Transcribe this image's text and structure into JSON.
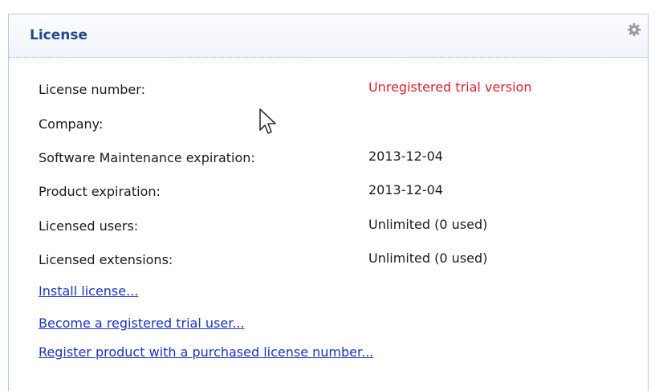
{
  "panel": {
    "title": "License"
  },
  "details": [
    {
      "label": "License number:",
      "value": "Unregistered trial version"
    },
    {
      "label": "Company:",
      "value": ""
    },
    {
      "label": "Software Maintenance expiration:",
      "value": "2013-12-04"
    },
    {
      "label": "Product expiration:",
      "value": "2013-12-04"
    },
    {
      "label": "Licensed users:",
      "value": "Unlimited (0 used)"
    },
    {
      "label": "Licensed extensions:",
      "value": "Unlimited (0 used)"
    }
  ],
  "links": {
    "install": "Install license...",
    "become_registered": "Become a registered trial user...",
    "register_product": "Register product with a purchased license number..."
  },
  "colors": {
    "title": "#1c4c8c",
    "warning": "#e8202a",
    "link": "#1a33cc",
    "border": "#b9c7dc"
  },
  "icons": {
    "settings": "gear-icon",
    "pointer": "mouse-cursor-icon"
  }
}
